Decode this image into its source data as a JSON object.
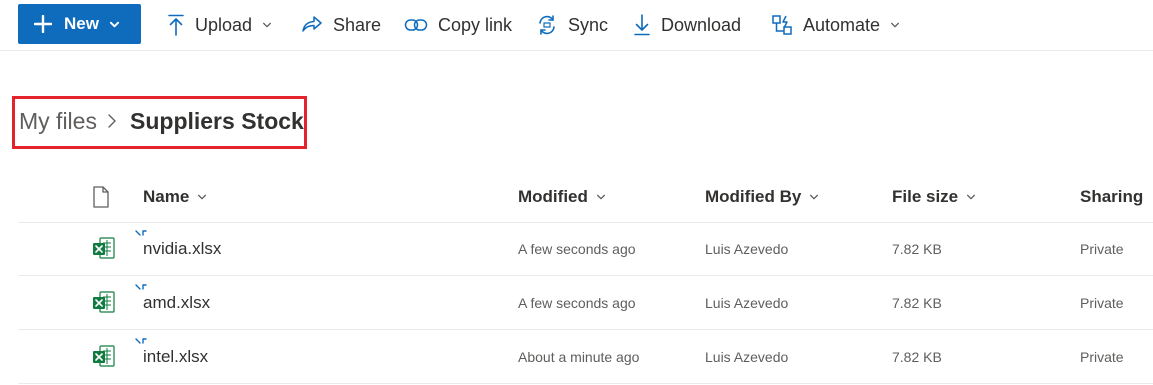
{
  "toolbar": {
    "new_label": "New",
    "upload_label": "Upload",
    "share_label": "Share",
    "copy_link_label": "Copy link",
    "sync_label": "Sync",
    "download_label": "Download",
    "automate_label": "Automate"
  },
  "breadcrumb": {
    "root": "My files",
    "current": "Suppliers Stock"
  },
  "table": {
    "headers": {
      "name": "Name",
      "modified": "Modified",
      "modified_by": "Modified By",
      "file_size": "File size",
      "sharing": "Sharing"
    },
    "rows": [
      {
        "name": "nvidia.xlsx",
        "modified": "A few seconds ago",
        "modified_by": "Luis Azevedo",
        "file_size": "7.82 KB",
        "sharing": "Private"
      },
      {
        "name": "amd.xlsx",
        "modified": "A few seconds ago",
        "modified_by": "Luis Azevedo",
        "file_size": "7.82 KB",
        "sharing": "Private"
      },
      {
        "name": "intel.xlsx",
        "modified": "About a minute ago",
        "modified_by": "Luis Azevedo",
        "file_size": "7.82 KB",
        "sharing": "Private"
      }
    ]
  },
  "colors": {
    "accent": "#0f6cbd",
    "highlight_box": "#e3222b",
    "excel_green": "#107c41"
  }
}
